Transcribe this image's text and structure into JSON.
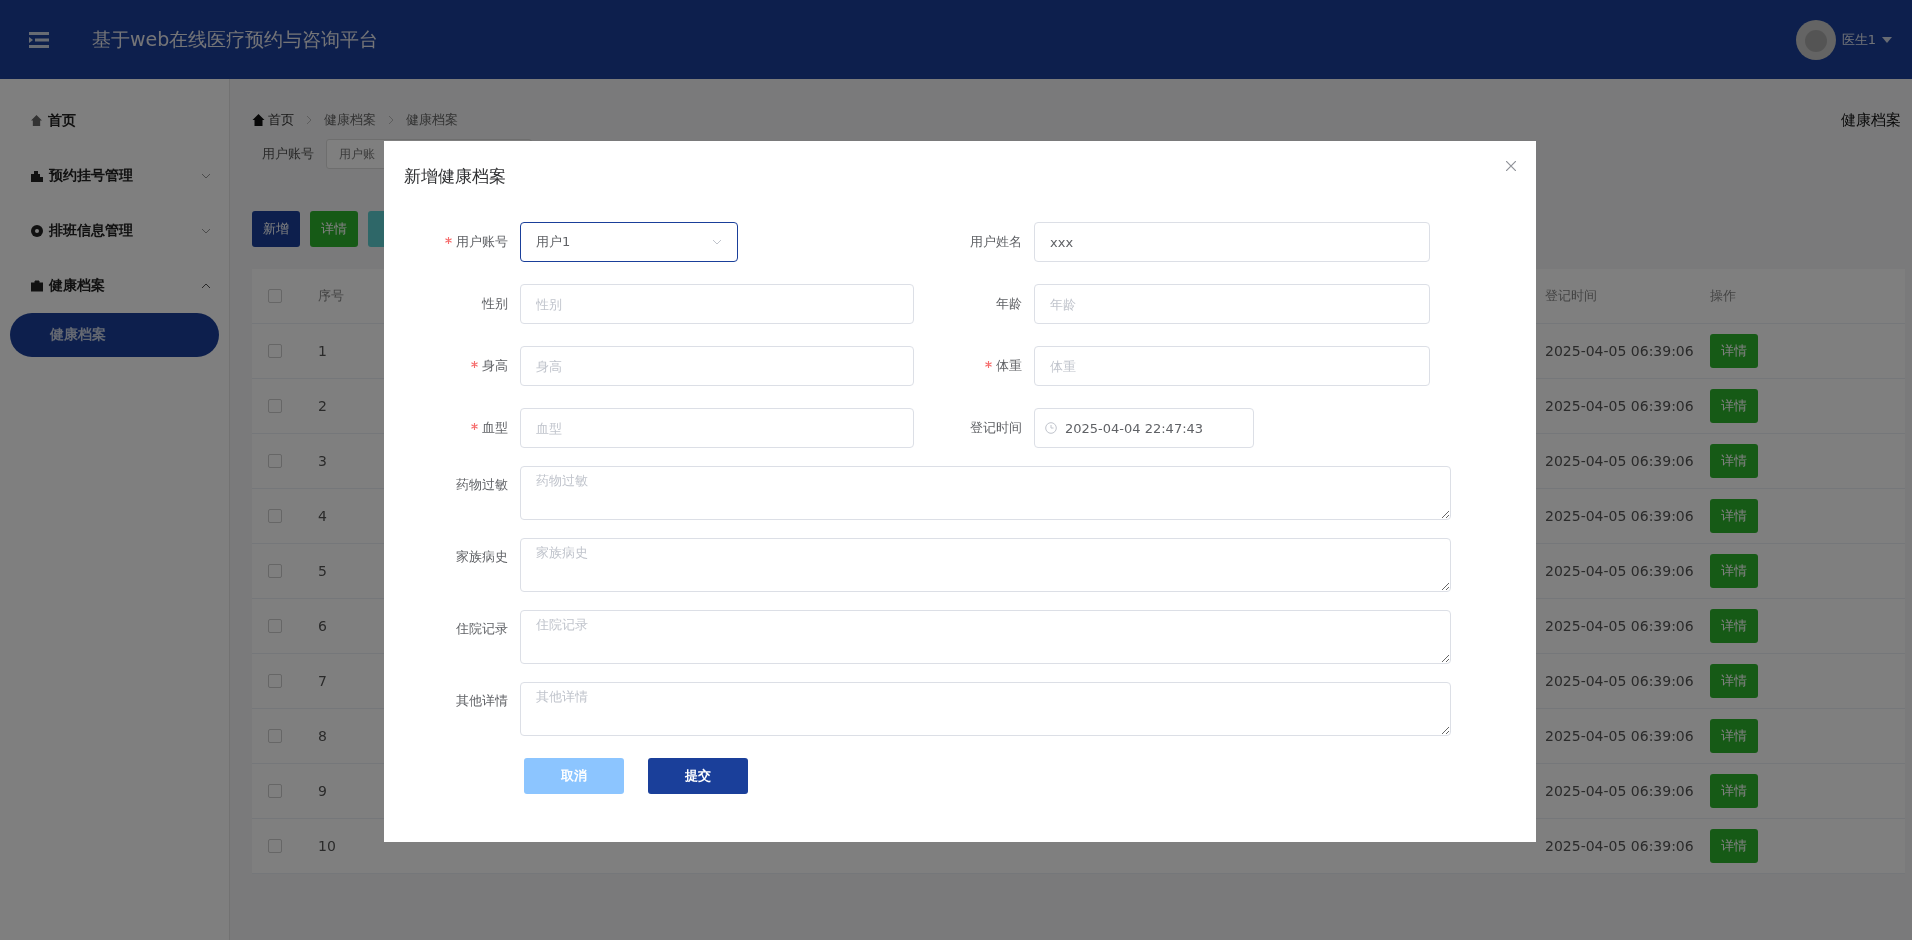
{
  "header": {
    "title": "基于web在线医疗预约与咨询平台",
    "user": "医生1"
  },
  "sidebar": {
    "items": [
      {
        "label": "首页"
      },
      {
        "label": "预约挂号管理",
        "expanded": false
      },
      {
        "label": "排班信息管理",
        "expanded": false
      },
      {
        "label": "健康档案",
        "expanded": true,
        "children": [
          {
            "label": "健康档案",
            "selected": true
          }
        ]
      }
    ]
  },
  "breadcrumb": [
    "首页",
    "健康档案",
    "健康档案"
  ],
  "page_title": "健康档案",
  "search": {
    "label": "用户账号",
    "placeholder": "用户账"
  },
  "toolbar": [
    {
      "label": "新增",
      "kind": "primary"
    },
    {
      "label": "详情",
      "kind": "success"
    },
    {
      "kind": "info"
    }
  ],
  "table": {
    "all_checked": false,
    "columns": [
      "序号",
      "登记时间",
      "操作"
    ],
    "rows": [
      {
        "index": "1",
        "time": "2025-04-05 06:39:06",
        "action": "详情",
        "checked": false
      },
      {
        "index": "2",
        "time": "2025-04-05 06:39:06",
        "action": "详情",
        "checked": false
      },
      {
        "index": "3",
        "time": "2025-04-05 06:39:06",
        "action": "详情",
        "checked": false
      },
      {
        "index": "4",
        "time": "2025-04-05 06:39:06",
        "action": "详情",
        "checked": false
      },
      {
        "index": "5",
        "time": "2025-04-05 06:39:06",
        "action": "详情",
        "checked": false
      },
      {
        "index": "6",
        "time": "2025-04-05 06:39:06",
        "action": "详情",
        "checked": false
      },
      {
        "index": "7",
        "time": "2025-04-05 06:39:06",
        "action": "详情",
        "checked": false
      },
      {
        "index": "8",
        "time": "2025-04-05 06:39:06",
        "action": "详情",
        "checked": false
      },
      {
        "index": "9",
        "time": "2025-04-05 06:39:06",
        "action": "详情",
        "checked": false
      },
      {
        "index": "10",
        "time": "2025-04-05 06:39:06",
        "action": "详情",
        "checked": false
      }
    ]
  },
  "dialog": {
    "title": "新增健康档案",
    "fields": [
      {
        "label": "用户账号",
        "kind": "select",
        "value": "用户1",
        "required": true,
        "focused": true
      },
      {
        "label": "用户姓名",
        "kind": "input",
        "value": "xxx",
        "required": false,
        "focused": false
      },
      {
        "label": "性别",
        "kind": "input",
        "placeholder": "性别",
        "required": false,
        "focused": false
      },
      {
        "label": "年龄",
        "kind": "input",
        "placeholder": "年龄",
        "required": false,
        "focused": false
      },
      {
        "label": "身高",
        "kind": "input",
        "placeholder": "身高",
        "required": true,
        "focused": false
      },
      {
        "label": "体重",
        "kind": "input",
        "placeholder": "体重",
        "required": true,
        "focused": false
      },
      {
        "label": "血型",
        "kind": "input",
        "placeholder": "血型",
        "required": true,
        "focused": false
      },
      {
        "label": "登记时间",
        "kind": "datetime",
        "value": "2025-04-04 22:47:43",
        "required": false,
        "focused": false
      },
      {
        "label": "药物过敏",
        "kind": "textarea",
        "placeholder": "药物过敏",
        "required": false,
        "focused": false
      },
      {
        "label": "家族病史",
        "kind": "textarea",
        "placeholder": "家族病史",
        "required": false,
        "focused": false
      },
      {
        "label": "住院记录",
        "kind": "textarea",
        "placeholder": "住院记录",
        "required": false,
        "focused": false
      },
      {
        "label": "其他详情",
        "kind": "textarea",
        "placeholder": "其他详情",
        "required": false,
        "focused": false
      }
    ],
    "buttons": [
      {
        "label": "取消",
        "kind": "cancel"
      },
      {
        "label": "提交",
        "kind": "submit"
      }
    ]
  }
}
